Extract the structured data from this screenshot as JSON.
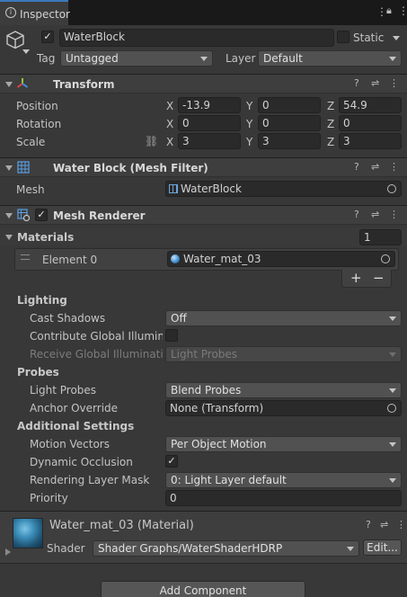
{
  "tab": {
    "icon": "info-icon",
    "label": "Inspector"
  },
  "go": {
    "name": "WaterBlock",
    "active": true,
    "static_label": "Static",
    "static_checked": false,
    "tag_label": "Tag",
    "tag_value": "Untagged",
    "layer_label": "Layer",
    "layer_value": "Default"
  },
  "transform": {
    "title": "Transform",
    "position": {
      "label": "Position",
      "x": "-13.9",
      "y": "0",
      "z": "54.9"
    },
    "rotation": {
      "label": "Rotation",
      "x": "0",
      "y": "0",
      "z": "0"
    },
    "scale": {
      "label": "Scale",
      "x": "3",
      "y": "3",
      "z": "3"
    },
    "axis": {
      "x": "X",
      "y": "Y",
      "z": "Z"
    }
  },
  "mesh_filter": {
    "title": "Water Block (Mesh Filter)",
    "mesh_label": "Mesh",
    "mesh_value": "WaterBlock"
  },
  "mesh_renderer": {
    "title": "Mesh Renderer",
    "enabled": true,
    "materials_label": "Materials",
    "materials_count": "1",
    "element_label": "Element 0",
    "element_value": "Water_mat_03",
    "add": "+",
    "remove": "−",
    "lighting_label": "Lighting",
    "cast_shadows_label": "Cast Shadows",
    "cast_shadows_value": "Off",
    "contribute_gi_label": "Contribute Global Illuminat",
    "receive_gi_label": "Receive Global Illuminatio",
    "receive_gi_value": "Light Probes",
    "probes_label": "Probes",
    "light_probes_label": "Light Probes",
    "light_probes_value": "Blend Probes",
    "anchor_label": "Anchor Override",
    "anchor_value": "None (Transform)",
    "additional_label": "Additional Settings",
    "motion_label": "Motion Vectors",
    "motion_value": "Per Object Motion",
    "occlusion_label": "Dynamic Occlusion",
    "occlusion_checked": true,
    "rlm_label": "Rendering Layer Mask",
    "rlm_value": "0: Light Layer default",
    "priority_label": "Priority",
    "priority_value": "0"
  },
  "material": {
    "title": "Water_mat_03 (Material)",
    "shader_label": "Shader",
    "shader_value": "Shader Graphs/WaterShaderHDRP",
    "edit_label": "Edit..."
  },
  "add_component": "Add Component"
}
